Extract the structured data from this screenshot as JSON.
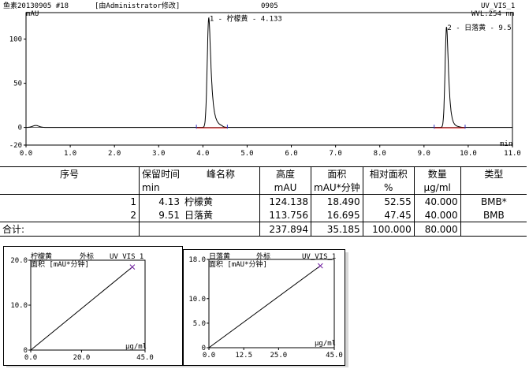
{
  "chart_data": [
    {
      "type": "line",
      "header": {
        "sample": "鱼素20130905 #18",
        "modified": "[由Administrator修改]",
        "sequence": "0905",
        "channel": "UV_VIS_1",
        "wavelength": "WVL:254 nm",
        "yunit": "mAU",
        "xunit": "min"
      },
      "xlim": [
        0.0,
        11.0
      ],
      "ylim": [
        -20,
        130
      ],
      "xticks": [
        "0.0",
        "1.0",
        "2.0",
        "3.0",
        "4.0",
        "5.0",
        "6.0",
        "7.0",
        "8.0",
        "9.0",
        "10.0",
        "11.0"
      ],
      "yticks": [
        "-20",
        "0",
        "50",
        "100"
      ],
      "peaks": [
        {
          "rt": 4.133,
          "height": 124.138,
          "sigma": 0.035,
          "tail": 0.07,
          "label": "1 - 柠檬黄 - 4.133"
        },
        {
          "rt": 9.51,
          "height": 113.756,
          "sigma": 0.033,
          "tail": 0.06,
          "label": "2 - 日落黄 - 9.5"
        }
      ]
    },
    {
      "type": "line",
      "title": "柠檬黄",
      "method": "外标",
      "channel": "UV_VIS_1",
      "ylabel": "面积 [mAU*分钟]",
      "xlabel": "μg/ml",
      "xlim": [
        0,
        45
      ],
      "ylim": [
        0,
        20
      ],
      "xticks": [
        "0.0",
        "20.0",
        "45.0"
      ],
      "yticks": [
        "0",
        "10.0",
        "20.0"
      ],
      "line": [
        [
          0,
          0
        ],
        [
          40,
          18.49
        ]
      ],
      "points": [
        [
          40,
          18.49
        ]
      ]
    },
    {
      "type": "line",
      "title": "日落黄",
      "method": "外标",
      "channel": "UV_VIS_1",
      "ylabel": "面积 [mAU*分钟]",
      "xlabel": "μg/ml",
      "xlim": [
        0,
        45
      ],
      "ylim": [
        0,
        18
      ],
      "xticks": [
        "0.0",
        "12.5",
        "25.0",
        "45.0"
      ],
      "yticks": [
        "0",
        "5.0",
        "10.0",
        "18.0"
      ],
      "line": [
        [
          0,
          0
        ],
        [
          40,
          16.695
        ]
      ],
      "points": [
        [
          40,
          16.695
        ]
      ]
    }
  ],
  "table": {
    "headers": [
      "序号",
      "保留时间",
      "峰名称",
      "高度",
      "面积",
      "相对面积",
      "数量",
      "类型"
    ],
    "units": [
      "",
      "min",
      "",
      "mAU",
      "mAU*分钟",
      "%",
      "μg/ml",
      ""
    ],
    "rows": [
      [
        "1",
        "4.13",
        "柠檬黄",
        "124.138",
        "18.490",
        "52.55",
        "40.000",
        "BMB*"
      ],
      [
        "2",
        "9.51",
        "日落黄",
        "113.756",
        "16.695",
        "47.45",
        "40.000",
        "BMB"
      ]
    ],
    "total": {
      "label": "合计:",
      "height": "237.894",
      "area": "35.185",
      "rel": "100.000",
      "amount": "80.000"
    }
  }
}
